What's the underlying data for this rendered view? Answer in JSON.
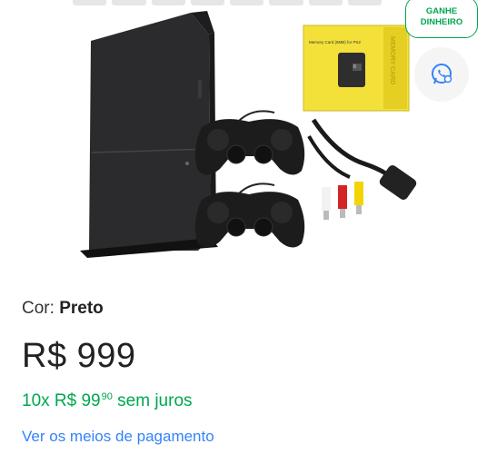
{
  "badge": {
    "line1": "GANHE",
    "line2": "DINHEIRO"
  },
  "memory_card": {
    "label": "Memory Card (8MB) for PS2",
    "side": "MEMORY CARD",
    "size": "8"
  },
  "product": {
    "color_label": "Cor:",
    "color_value": "Preto",
    "price": "R$ 999",
    "installments_prefix": "10x R$ 99",
    "installments_cents": "90",
    "installments_suffix": "sem juros",
    "payment_link": "Ver os meios de pagamento"
  },
  "colors": {
    "accent_green": "#00a650",
    "link_blue": "#3483fa"
  },
  "icons": {
    "share": "whatsapp-icon"
  }
}
